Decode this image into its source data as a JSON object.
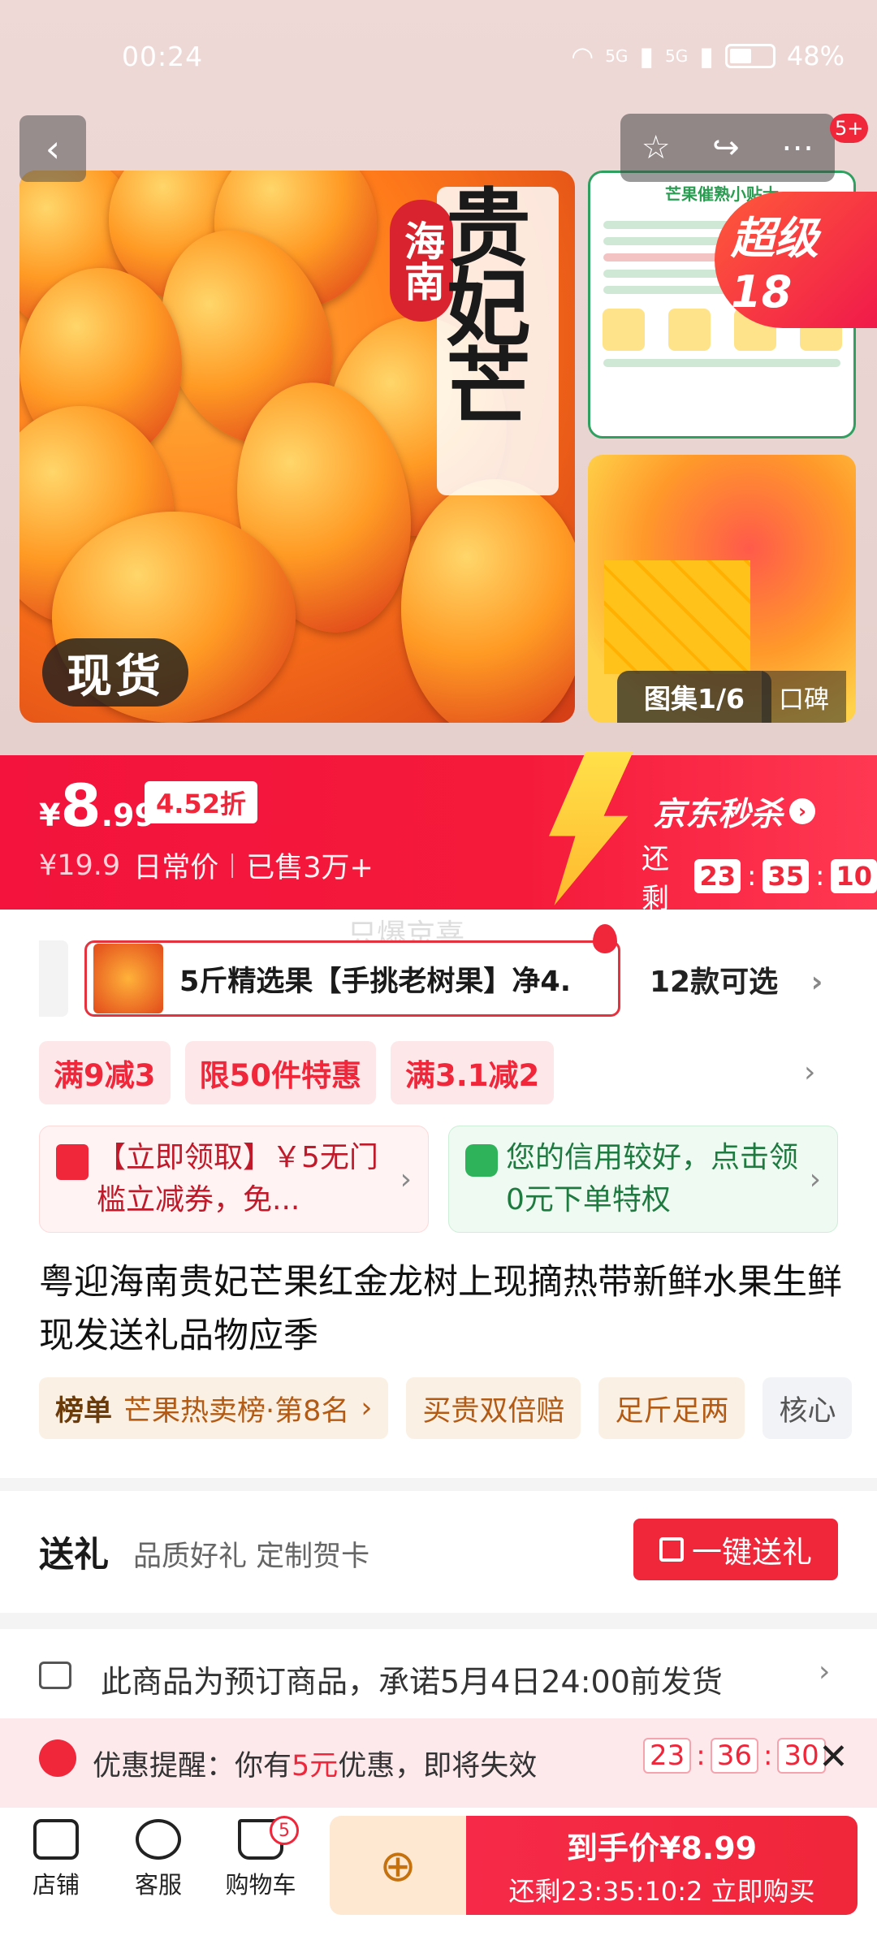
{
  "status": {
    "time": "00:24",
    "signal1": "5G",
    "signal2": "5G",
    "battery": "48%"
  },
  "topbar": {
    "back_icon": "chevron-left-icon",
    "notif_badge": "5+"
  },
  "hero": {
    "main_title": "贵妃芒",
    "seal_text": "海南",
    "badge_text": "现货",
    "side_card_title": "芒果催熟小贴士",
    "gallery_label": "图集1/6",
    "koubei_label": "口碑",
    "super_badge": "超级18"
  },
  "price": {
    "currency": "¥",
    "integer": "8",
    "decimal": ".99",
    "discount": "4.52折",
    "list_price": "¥19.9",
    "list_label": "日常价",
    "sold": "已售3万+",
    "seckill_label": "京东秒杀",
    "countdown_label": "还剩",
    "cd_h": "23",
    "cd_m": "35",
    "cd_s": "10"
  },
  "watermark": "只爆京喜",
  "sku": {
    "selected": "5斤精选果【手挑老树果】净4.",
    "more": "12款可选"
  },
  "promos": [
    "满9减3",
    "限50件特惠",
    "满3.1减2"
  ],
  "coupon_card": {
    "text": "【立即领取】￥5无门槛立减券，免..."
  },
  "credit_card": {
    "text": "您的信用较好，点击领0元下单特权"
  },
  "product_title": "粤迎海南贵妃芒果红金龙树上现摘热带新鲜水果生鲜现发送礼品物应季",
  "tags": {
    "rank_label": "榜单",
    "rank_value": "芒果热卖榜·第8名",
    "t1": "买贵双倍赔",
    "t2": "足斤足两",
    "t3": "核心"
  },
  "gift": {
    "title": "送礼",
    "subtitle": "品质好礼 定制贺卡",
    "button": "一键送礼"
  },
  "shipping": {
    "text": "此商品为预订商品，承诺5月4日24:00前发货"
  },
  "reminder": {
    "prefix": "优惠提醒：你有",
    "amount": "5元",
    "suffix": "优惠，即将失效",
    "h": "23",
    "m": "36",
    "s": "30"
  },
  "bottom": {
    "shop": "店铺",
    "service": "客服",
    "cart": "购物车",
    "cart_count": "5",
    "buy_line1": "到手价¥8.99",
    "buy_line2": "还剩23:35:10:2 立即购买"
  }
}
